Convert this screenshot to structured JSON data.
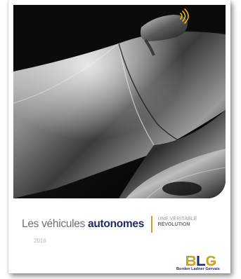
{
  "cover": {
    "title_light": "Les véhicules",
    "title_bold": "autonomes",
    "subtitle_line1": "UNE VÉRITABLE",
    "subtitle_line2": "RÉVOLUTION",
    "year": "2016"
  },
  "brand": {
    "logo_letters": "BLG",
    "firm_name": "Borden Ladner Gervais",
    "accent_color": "#c9a227",
    "navy_color": "#1f2a6b"
  },
  "hero_image": {
    "subject": "car-hood-photo",
    "sensor_icon": "wireless-signal-icon"
  }
}
